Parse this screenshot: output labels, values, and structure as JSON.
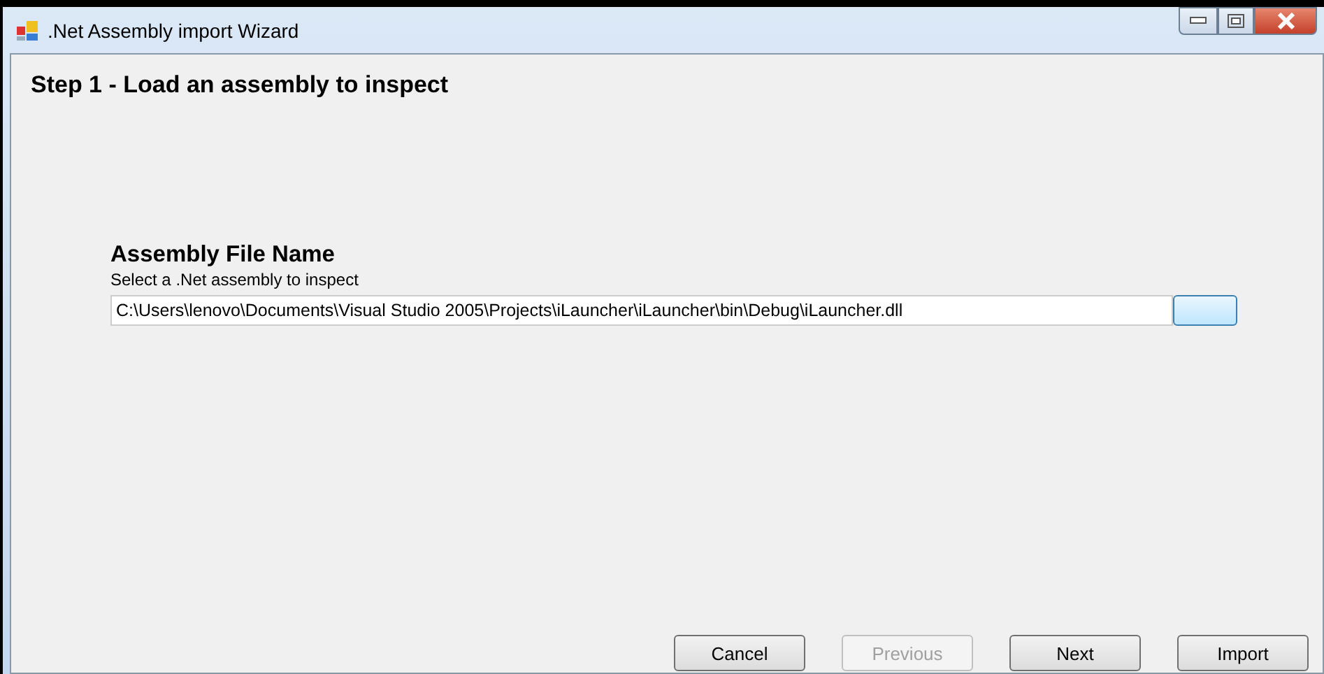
{
  "window": {
    "title": ".Net Assembly import Wizard"
  },
  "step_title": "Step 1 - Load an assembly to inspect",
  "file_section": {
    "heading": "Assembly File Name",
    "hint": "Select a .Net assembly to inspect",
    "value": "C:\\Users\\lenovo\\Documents\\Visual Studio 2005\\Projects\\iLauncher\\iLauncher\\bin\\Debug\\iLauncher.dll"
  },
  "buttons": [
    {
      "label": "Cancel",
      "disabled": false
    },
    {
      "label": "Previous",
      "disabled": true
    },
    {
      "label": "Next",
      "disabled": false
    },
    {
      "label": "Import",
      "disabled": false
    }
  ]
}
